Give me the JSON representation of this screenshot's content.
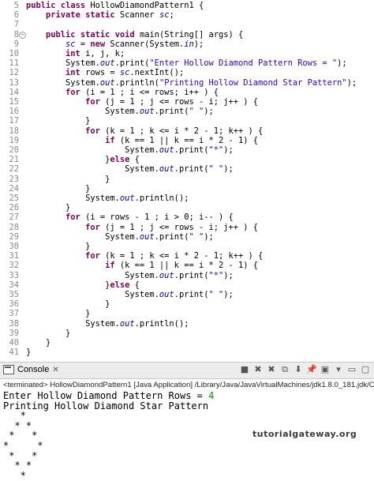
{
  "editor": {
    "lines": [
      {
        "num": "5",
        "segs": [
          [
            "kw",
            "public"
          ],
          [
            "t",
            " "
          ],
          [
            "kw",
            "class"
          ],
          [
            "t",
            " HollowDiamondPattern1 {"
          ]
        ]
      },
      {
        "num": "6",
        "segs": [
          [
            "t",
            "    "
          ],
          [
            "kw",
            "private"
          ],
          [
            "t",
            " "
          ],
          [
            "kw",
            "static"
          ],
          [
            "t",
            " Scanner "
          ],
          [
            "fld",
            "sc"
          ],
          [
            "t",
            ";"
          ]
        ]
      },
      {
        "num": "7",
        "segs": [
          [
            "t",
            "    "
          ]
        ]
      },
      {
        "num": "8",
        "fold": true,
        "segs": [
          [
            "t",
            "    "
          ],
          [
            "kw",
            "public"
          ],
          [
            "t",
            " "
          ],
          [
            "kw",
            "static"
          ],
          [
            "t",
            " "
          ],
          [
            "kw",
            "void"
          ],
          [
            "t",
            " main(String[] args) {"
          ]
        ]
      },
      {
        "num": "9",
        "segs": [
          [
            "t",
            "        "
          ],
          [
            "fld",
            "sc"
          ],
          [
            "t",
            " = "
          ],
          [
            "kw",
            "new"
          ],
          [
            "t",
            " Scanner(System."
          ],
          [
            "fld",
            "in"
          ],
          [
            "t",
            ");"
          ]
        ]
      },
      {
        "num": "10",
        "segs": [
          [
            "t",
            "        "
          ],
          [
            "kw",
            "int"
          ],
          [
            "t",
            " i, j, k;"
          ]
        ]
      },
      {
        "num": "11",
        "segs": [
          [
            "t",
            "        System."
          ],
          [
            "fld",
            "out"
          ],
          [
            "t",
            ".print("
          ],
          [
            "str",
            "\"Enter Hollow Diamond Pattern Rows = \""
          ],
          [
            "t",
            ");"
          ]
        ]
      },
      {
        "num": "12",
        "segs": [
          [
            "t",
            "        "
          ],
          [
            "kw",
            "int"
          ],
          [
            "t",
            " rows = "
          ],
          [
            "fld",
            "sc"
          ],
          [
            "t",
            ".nextInt();"
          ]
        ]
      },
      {
        "num": "13",
        "segs": [
          [
            "t",
            "        System."
          ],
          [
            "fld",
            "out"
          ],
          [
            "t",
            ".println("
          ],
          [
            "str",
            "\"Printing Hollow Diamond Star Pattern\""
          ],
          [
            "t",
            ");"
          ]
        ]
      },
      {
        "num": "14",
        "segs": [
          [
            "t",
            "        "
          ],
          [
            "kw",
            "for"
          ],
          [
            "t",
            " (i = 1 ; i <= rows; i++ ) {"
          ]
        ]
      },
      {
        "num": "15",
        "segs": [
          [
            "t",
            "            "
          ],
          [
            "kw",
            "for"
          ],
          [
            "t",
            " (j = 1 ; j <= rows - i; j++ ) {"
          ]
        ]
      },
      {
        "num": "16",
        "segs": [
          [
            "t",
            "                System."
          ],
          [
            "fld",
            "out"
          ],
          [
            "t",
            ".print("
          ],
          [
            "str",
            "\" \""
          ],
          [
            "t",
            ");"
          ]
        ]
      },
      {
        "num": "17",
        "segs": [
          [
            "t",
            "            }"
          ]
        ]
      },
      {
        "num": "18",
        "segs": [
          [
            "t",
            "            "
          ],
          [
            "kw",
            "for"
          ],
          [
            "t",
            " (k = 1 ; k <= i * 2 - 1; k++ ) {"
          ]
        ]
      },
      {
        "num": "19",
        "segs": [
          [
            "t",
            "                "
          ],
          [
            "kw",
            "if"
          ],
          [
            "t",
            " (k == 1 || k == i * 2 - 1) {"
          ]
        ]
      },
      {
        "num": "20",
        "segs": [
          [
            "t",
            "                    System."
          ],
          [
            "fld",
            "out"
          ],
          [
            "t",
            ".print("
          ],
          [
            "str",
            "\"*\""
          ],
          [
            "t",
            ");"
          ]
        ]
      },
      {
        "num": "21",
        "segs": [
          [
            "t",
            "                }"
          ],
          [
            "kw",
            "else"
          ],
          [
            "t",
            " {"
          ]
        ]
      },
      {
        "num": "22",
        "segs": [
          [
            "t",
            "                    System."
          ],
          [
            "fld",
            "out"
          ],
          [
            "t",
            ".print("
          ],
          [
            "str",
            "\" \""
          ],
          [
            "t",
            ");"
          ]
        ]
      },
      {
        "num": "23",
        "segs": [
          [
            "t",
            "                }"
          ]
        ]
      },
      {
        "num": "24",
        "segs": [
          [
            "t",
            "            }"
          ]
        ]
      },
      {
        "num": "25",
        "segs": [
          [
            "t",
            "            System."
          ],
          [
            "fld",
            "out"
          ],
          [
            "t",
            ".println();"
          ]
        ]
      },
      {
        "num": "26",
        "segs": [
          [
            "t",
            "        }"
          ]
        ]
      },
      {
        "num": "27",
        "segs": [
          [
            "t",
            "        "
          ],
          [
            "kw",
            "for"
          ],
          [
            "t",
            " (i = rows - 1 ; i > 0; i-- ) {"
          ]
        ]
      },
      {
        "num": "28",
        "segs": [
          [
            "t",
            "            "
          ],
          [
            "kw",
            "for"
          ],
          [
            "t",
            " (j = 1 ; j <= rows - i; j++ ) {"
          ]
        ]
      },
      {
        "num": "29",
        "segs": [
          [
            "t",
            "                System."
          ],
          [
            "fld",
            "out"
          ],
          [
            "t",
            ".print("
          ],
          [
            "str",
            "\" \""
          ],
          [
            "t",
            ");"
          ]
        ]
      },
      {
        "num": "30",
        "segs": [
          [
            "t",
            "            }"
          ]
        ]
      },
      {
        "num": "31",
        "segs": [
          [
            "t",
            "            "
          ],
          [
            "kw",
            "for"
          ],
          [
            "t",
            " (k = 1 ; k <= i * 2 - 1; k++ ) {"
          ]
        ]
      },
      {
        "num": "32",
        "segs": [
          [
            "t",
            "                "
          ],
          [
            "kw",
            "if"
          ],
          [
            "t",
            " (k == 1 || k == i * 2 - 1) {"
          ]
        ]
      },
      {
        "num": "33",
        "segs": [
          [
            "t",
            "                    System."
          ],
          [
            "fld",
            "out"
          ],
          [
            "t",
            ".print("
          ],
          [
            "str",
            "\"*\""
          ],
          [
            "t",
            ");"
          ]
        ]
      },
      {
        "num": "34",
        "segs": [
          [
            "t",
            "                }"
          ],
          [
            "kw",
            "else"
          ],
          [
            "t",
            " {"
          ]
        ]
      },
      {
        "num": "35",
        "segs": [
          [
            "t",
            "                    System."
          ],
          [
            "fld",
            "out"
          ],
          [
            "t",
            ".print("
          ],
          [
            "str",
            "\" \""
          ],
          [
            "t",
            ");"
          ]
        ]
      },
      {
        "num": "36",
        "segs": [
          [
            "t",
            "                }"
          ]
        ]
      },
      {
        "num": "37",
        "segs": [
          [
            "t",
            "            }"
          ]
        ]
      },
      {
        "num": "38",
        "segs": [
          [
            "t",
            "            System."
          ],
          [
            "fld",
            "out"
          ],
          [
            "t",
            ".println();"
          ]
        ]
      },
      {
        "num": "39",
        "segs": [
          [
            "t",
            "        }"
          ]
        ]
      },
      {
        "num": "40",
        "segs": [
          [
            "t",
            "    }"
          ]
        ]
      },
      {
        "num": "41",
        "segs": [
          [
            "t",
            "}"
          ]
        ]
      }
    ]
  },
  "console": {
    "tab_label": "Console",
    "tab_close": "✕",
    "status_line": "<terminated> HollowDiamondPattern1 [Java Application] /Library/Java/JavaVirtualMachines/jdk1.8.0_181.jdk/Conten",
    "prompt": "Enter Hollow Diamond Pattern Rows = ",
    "input_value": "4",
    "output_lines": [
      "Printing Hollow Diamond Star Pattern",
      "   *",
      "  * *",
      " *   *",
      "*     *",
      " *   *",
      "  * *",
      "   *"
    ]
  },
  "toolbar": {
    "icons": [
      "terminate-icon",
      "remove-launch-icon",
      "remove-all-icon",
      "copy-icon",
      "scroll-lock-icon",
      "pin-icon",
      "display-console-icon",
      "open-console-icon",
      "minimize-icon",
      "maximize-icon"
    ],
    "glyphs": [
      "■",
      "✖",
      "✖",
      "⧉",
      "⬇",
      "📌",
      "▣",
      "▾",
      "▭",
      "▢"
    ]
  },
  "watermark": "tutorialgateway.org",
  "colors": {
    "keyword": "#7f0055",
    "string": "#2a00ff",
    "field": "#0000c0",
    "input": "#009b00"
  }
}
